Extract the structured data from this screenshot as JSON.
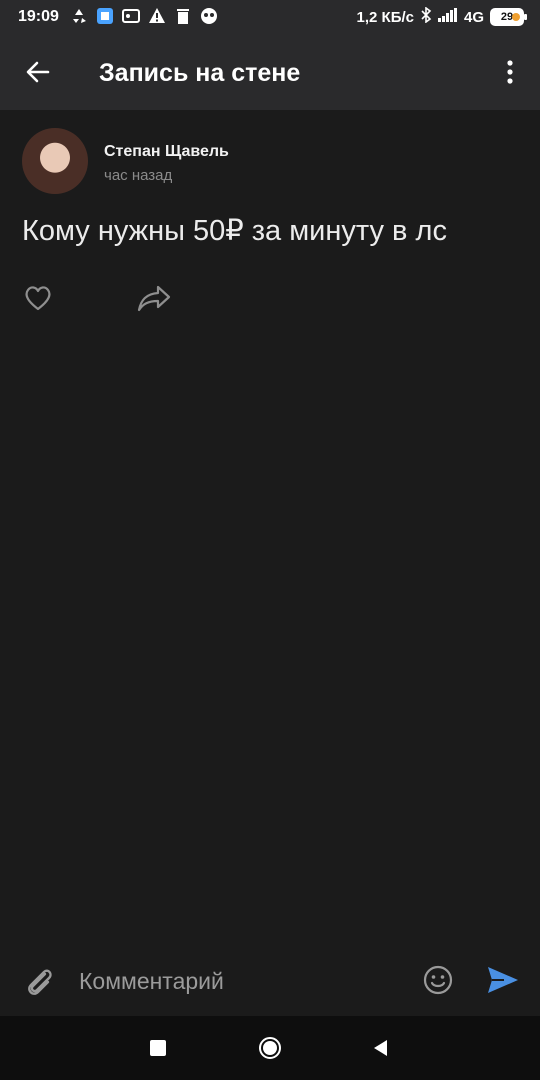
{
  "status_bar": {
    "time": "19:09",
    "speed": "1,2 КБ/с",
    "network": "4G",
    "battery": "29",
    "icons": [
      "recycle-icon",
      "app-icon",
      "rss-icon",
      "warning-icon",
      "trash-icon",
      "paw-icon",
      "bluetooth-icon",
      "signal-icon",
      "battery-icon"
    ]
  },
  "header": {
    "title": "Запись на стене",
    "icons": [
      "back-arrow-icon",
      "more-vertical-icon"
    ]
  },
  "post": {
    "author": "Степан Щавель",
    "time_ago": "час назад",
    "text": "Кому нужны 50₽ за минуту в лс",
    "actions": [
      "heart-icon",
      "share-icon"
    ]
  },
  "composer": {
    "placeholder": "Комментарий",
    "icons": [
      "paperclip-icon",
      "emoji-icon",
      "send-icon"
    ],
    "send_color": "#4a90e2"
  },
  "navbar": {
    "icons": [
      "recent-apps-icon",
      "home-icon",
      "back-icon"
    ]
  }
}
